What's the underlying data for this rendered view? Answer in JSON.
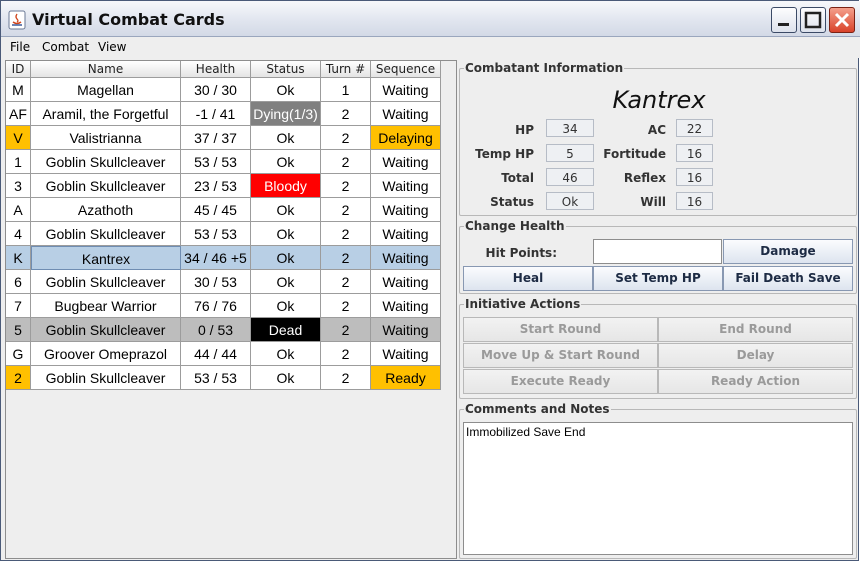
{
  "window": {
    "title": "Virtual Combat Cards"
  },
  "menu": [
    "File",
    "Combat",
    "View"
  ],
  "table": {
    "columns": [
      "ID",
      "Name",
      "Health",
      "Status",
      "Turn #",
      "Sequence"
    ],
    "rows": [
      {
        "id": "M",
        "name": "Magellan",
        "health": "30 / 30",
        "status": "Ok",
        "turn": "1",
        "sequence": "Waiting"
      },
      {
        "id": "AF",
        "name": "Aramil, the Forgetful",
        "health": "-1 / 41",
        "status": "Dying(1/3)",
        "turn": "2",
        "sequence": "Waiting"
      },
      {
        "id": "V",
        "name": "Valistrianna",
        "health": "37 / 37",
        "status": "Ok",
        "turn": "2",
        "sequence": "Delaying"
      },
      {
        "id": "1",
        "name": "Goblin Skullcleaver",
        "health": "53 / 53",
        "status": "Ok",
        "turn": "2",
        "sequence": "Waiting"
      },
      {
        "id": "3",
        "name": "Goblin Skullcleaver",
        "health": "23 / 53",
        "status": "Bloody",
        "turn": "2",
        "sequence": "Waiting"
      },
      {
        "id": "A",
        "name": "Azathoth",
        "health": "45 / 45",
        "status": "Ok",
        "turn": "2",
        "sequence": "Waiting"
      },
      {
        "id": "4",
        "name": "Goblin Skullcleaver",
        "health": "53 / 53",
        "status": "Ok",
        "turn": "2",
        "sequence": "Waiting"
      },
      {
        "id": "K",
        "name": "Kantrex",
        "health": "34 / 46 +5",
        "status": "Ok",
        "turn": "2",
        "sequence": "Waiting"
      },
      {
        "id": "6",
        "name": "Goblin Skullcleaver",
        "health": "30 / 53",
        "status": "Ok",
        "turn": "2",
        "sequence": "Waiting"
      },
      {
        "id": "7",
        "name": "Bugbear Warrior",
        "health": "76 / 76",
        "status": "Ok",
        "turn": "2",
        "sequence": "Waiting"
      },
      {
        "id": "5",
        "name": "Goblin Skullcleaver",
        "health": "0 / 53",
        "status": "Dead",
        "turn": "2",
        "sequence": "Waiting"
      },
      {
        "id": "G",
        "name": "Groover Omeprazol",
        "health": "44 / 44",
        "status": "Ok",
        "turn": "2",
        "sequence": "Waiting"
      },
      {
        "id": "2",
        "name": "Goblin Skullcleaver",
        "health": "53 / 53",
        "status": "Ok",
        "turn": "2",
        "sequence": "Ready"
      }
    ]
  },
  "colors": {
    "highlight": "#ffc000",
    "dying": "#808080",
    "bloody": "#ff0000",
    "dead": "#000000",
    "selected": "#b8cfe5",
    "dead_row": "#bdbdbd"
  },
  "combatant": {
    "group_title": "Combatant Information",
    "name": "Kantrex",
    "hp_label": "HP",
    "hp": "34",
    "temp_hp_label": "Temp HP",
    "temp_hp": "5",
    "total_label": "Total",
    "total": "46",
    "status_label": "Status",
    "status": "Ok",
    "ac_label": "AC",
    "ac": "22",
    "fortitude_label": "Fortitude",
    "fortitude": "16",
    "reflex_label": "Reflex",
    "reflex": "16",
    "will_label": "Will",
    "will": "16"
  },
  "change_health": {
    "group_title": "Change Health",
    "hit_points_label": "Hit Points:",
    "hit_points_value": "",
    "damage": "Damage",
    "heal": "Heal",
    "set_temp_hp": "Set Temp HP",
    "fail_death_save": "Fail Death Save"
  },
  "initiative": {
    "group_title": "Initiative Actions",
    "start_round": "Start Round",
    "end_round": "End Round",
    "move_up_start_round": "Move Up & Start Round",
    "delay": "Delay",
    "execute_ready": "Execute Ready",
    "ready_action": "Ready Action"
  },
  "notes": {
    "group_title": "Comments and Notes",
    "text": "Immobilized Save End"
  }
}
